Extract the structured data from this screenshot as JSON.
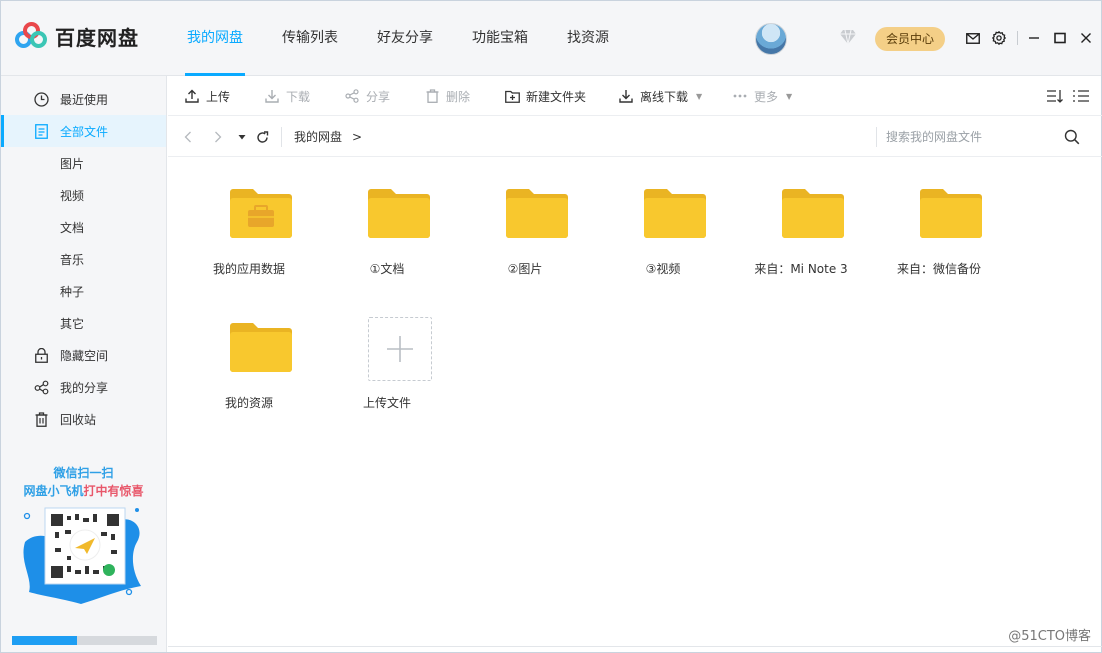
{
  "app": {
    "logo_text": "百度网盘",
    "vip_label": "会员中心",
    "accent_color": "#09aaff",
    "folder_color": "#f8c82e"
  },
  "nav": {
    "tabs": [
      {
        "label": "我的网盘",
        "active": true
      },
      {
        "label": "传输列表",
        "active": false
      },
      {
        "label": "好友分享",
        "active": false
      },
      {
        "label": "功能宝箱",
        "active": false
      },
      {
        "label": "找资源",
        "active": false
      }
    ]
  },
  "window_icons": [
    "mail-icon",
    "settings-icon",
    "minimize-icon",
    "maximize-icon",
    "close-icon"
  ],
  "sidebar": {
    "items": [
      {
        "label": "最近使用",
        "icon": "clock-icon",
        "active": false,
        "sub": false
      },
      {
        "label": "全部文件",
        "icon": "document-icon",
        "active": true,
        "sub": false
      },
      {
        "label": "图片",
        "icon": "",
        "active": false,
        "sub": true
      },
      {
        "label": "视频",
        "icon": "",
        "active": false,
        "sub": true
      },
      {
        "label": "文档",
        "icon": "",
        "active": false,
        "sub": true
      },
      {
        "label": "音乐",
        "icon": "",
        "active": false,
        "sub": true
      },
      {
        "label": "种子",
        "icon": "",
        "active": false,
        "sub": true
      },
      {
        "label": "其它",
        "icon": "",
        "active": false,
        "sub": true
      },
      {
        "label": "隐藏空间",
        "icon": "lock-icon",
        "active": false,
        "sub": false
      },
      {
        "label": "我的分享",
        "icon": "share-icon",
        "active": false,
        "sub": false
      },
      {
        "label": "回收站",
        "icon": "trash-icon",
        "active": false,
        "sub": false
      }
    ],
    "promo": {
      "line1": "微信扫一扫",
      "line2_a": "网盘小飞机",
      "line2_b": "打中有惊喜"
    },
    "storage_progress": 0.45
  },
  "toolbar": {
    "upload": "上传",
    "download": "下载",
    "share": "分享",
    "delete": "删除",
    "new_folder": "新建文件夹",
    "offline_download": "离线下载",
    "more": "更多"
  },
  "pathbar": {
    "breadcrumb": "我的网盘",
    "search_placeholder": "搜索我的网盘文件"
  },
  "files": [
    {
      "name": "我的应用数据",
      "type": "app-folder"
    },
    {
      "name": "①文档",
      "type": "folder"
    },
    {
      "name": "②图片",
      "type": "folder"
    },
    {
      "name": "③视频",
      "type": "folder"
    },
    {
      "name": "来自：Mi Note 3",
      "type": "folder"
    },
    {
      "name": "来自：微信备份",
      "type": "folder"
    },
    {
      "name": "我的资源",
      "type": "folder"
    }
  ],
  "upload_tile_label": "上传文件",
  "watermark": "@51CTO博客"
}
